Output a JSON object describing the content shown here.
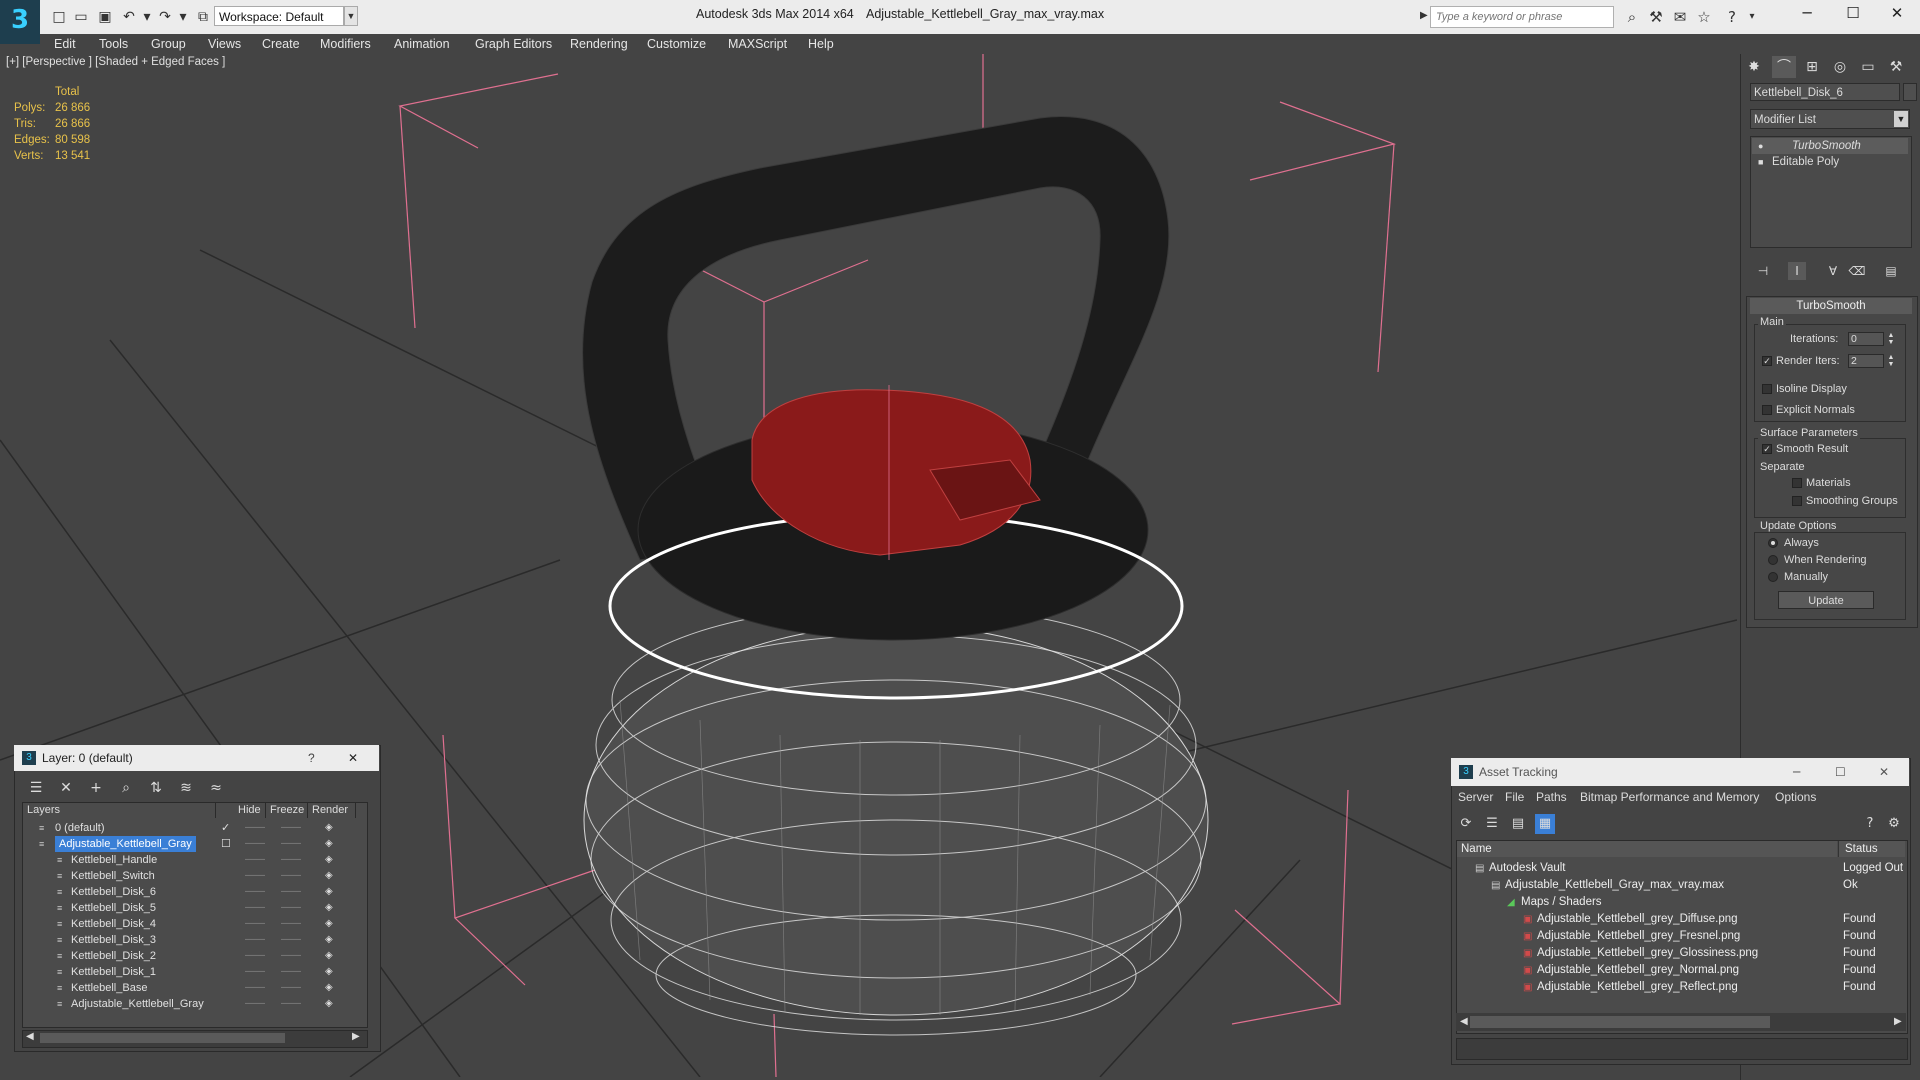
{
  "app": {
    "title": "Autodesk 3ds Max  2014 x64",
    "file": "Adjustable_Kettlebell_Gray_max_vray.max",
    "workspace": "Workspace: Default",
    "search_placeholder": "Type a keyword or phrase"
  },
  "menu": [
    "Edit",
    "Tools",
    "Group",
    "Views",
    "Create",
    "Modifiers",
    "Animation",
    "Graph Editors",
    "Rendering",
    "Customize",
    "MAXScript",
    "Help"
  ],
  "viewport": {
    "label": "[+] [Perspective ] [Shaded + Edged Faces ]",
    "stats": {
      "header": "Total",
      "rows": [
        {
          "k": "Polys:",
          "v": "26 866"
        },
        {
          "k": "Tris:",
          "v": "26 866"
        },
        {
          "k": "Edges:",
          "v": "80 598"
        },
        {
          "k": "Verts:",
          "v": "13 541"
        }
      ]
    }
  },
  "command_panel": {
    "object_name": "Kettlebell_Disk_6",
    "modifier_list": "Modifier List",
    "stack": [
      "TurboSmooth",
      "Editable Poly"
    ],
    "rollout": {
      "title": "TurboSmooth",
      "main_group": "Main",
      "iterations_label": "Iterations:",
      "iterations_value": "0",
      "render_iters_label": "Render Iters:",
      "render_iters_value": "2",
      "isoline": "Isoline Display",
      "explicit_normals": "Explicit Normals",
      "surface_group": "Surface Parameters",
      "smooth_result": "Smooth Result",
      "separate": "Separate",
      "materials": "Materials",
      "smoothing_groups": "Smoothing Groups",
      "update_group": "Update Options",
      "always": "Always",
      "when_rendering": "When Rendering",
      "manually": "Manually",
      "update_button": "Update"
    }
  },
  "layer_window": {
    "title": "Layer: 0 (default)",
    "help": "?",
    "columns": [
      "Layers",
      "Hide",
      "Freeze",
      "Render"
    ],
    "rows": [
      {
        "name": "0 (default)",
        "level": 0
      },
      {
        "name": "Adjustable_Kettlebell_Gray",
        "level": 0,
        "selected": true
      },
      {
        "name": "Kettlebell_Handle",
        "level": 1
      },
      {
        "name": "Kettlebell_Switch",
        "level": 1
      },
      {
        "name": "Kettlebell_Disk_6",
        "level": 1
      },
      {
        "name": "Kettlebell_Disk_5",
        "level": 1
      },
      {
        "name": "Kettlebell_Disk_4",
        "level": 1
      },
      {
        "name": "Kettlebell_Disk_3",
        "level": 1
      },
      {
        "name": "Kettlebell_Disk_2",
        "level": 1
      },
      {
        "name": "Kettlebell_Disk_1",
        "level": 1
      },
      {
        "name": "Kettlebell_Base",
        "level": 1
      },
      {
        "name": "Adjustable_Kettlebell_Gray",
        "level": 1
      }
    ]
  },
  "asset_tracking": {
    "title": "Asset Tracking",
    "menu": [
      "Server",
      "File",
      "Paths",
      "Bitmap Performance and Memory",
      "Options"
    ],
    "columns": [
      "Name",
      "Status"
    ],
    "rows": [
      {
        "name": "Autodesk Vault",
        "status": "Logged Out",
        "indent": 0
      },
      {
        "name": "Adjustable_Kettlebell_Gray_max_vray.max",
        "status": "Ok",
        "indent": 1
      },
      {
        "name": "Maps / Shaders",
        "status": "",
        "indent": 2
      },
      {
        "name": "Adjustable_Kettlebell_grey_Diffuse.png",
        "status": "Found",
        "indent": 3
      },
      {
        "name": "Adjustable_Kettlebell_grey_Fresnel.png",
        "status": "Found",
        "indent": 3
      },
      {
        "name": "Adjustable_Kettlebell_grey_Glossiness.png",
        "status": "Found",
        "indent": 3
      },
      {
        "name": "Adjustable_Kettlebell_grey_Normal.png",
        "status": "Found",
        "indent": 3
      },
      {
        "name": "Adjustable_Kettlebell_grey_Reflect.png",
        "status": "Found",
        "indent": 3
      }
    ]
  },
  "colors": {
    "stats": "#e8c24a",
    "selection": "#3a7fd6",
    "bbox": "#e07090",
    "accent_icon": "#39d0ff"
  }
}
